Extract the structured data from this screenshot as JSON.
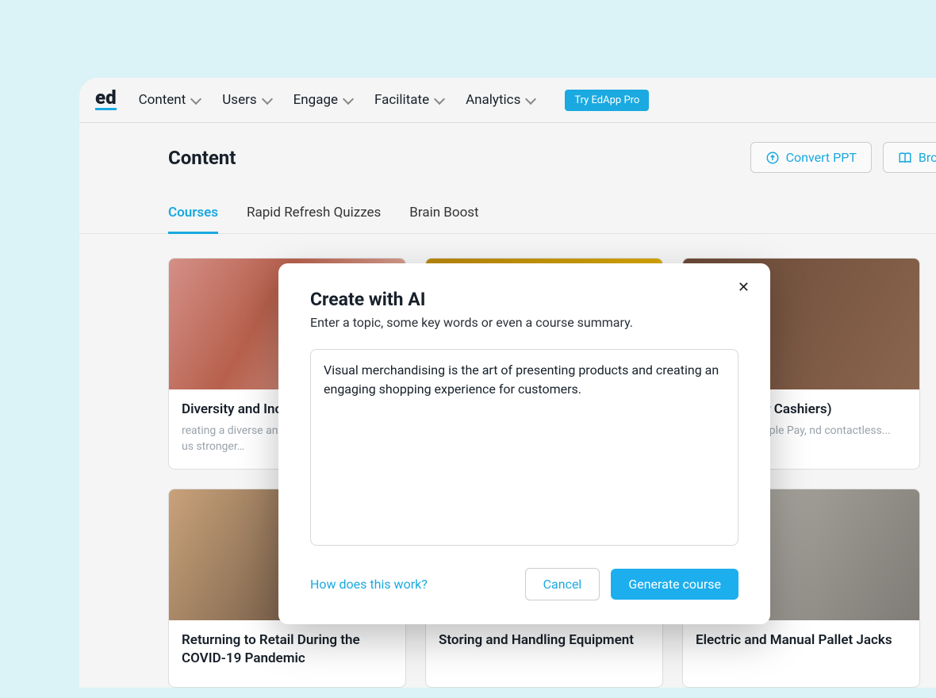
{
  "logo": "ed",
  "nav": {
    "items": [
      {
        "label": "Content"
      },
      {
        "label": "Users"
      },
      {
        "label": "Engage"
      },
      {
        "label": "Facilitate"
      },
      {
        "label": "Analytics"
      }
    ],
    "try_pro": "Try EdApp Pro"
  },
  "page": {
    "title": "Content",
    "actions": {
      "convert_ppt": "Convert PPT",
      "browse": "Browse"
    }
  },
  "tabs": [
    {
      "label": "Courses",
      "active": true
    },
    {
      "label": "Rapid Refresh Quizzes",
      "active": false
    },
    {
      "label": "Brain Boost",
      "active": false
    }
  ],
  "cards": [
    {
      "title": "Diversity and Inclusion in Retail",
      "desc": "reating a diverse and inclusive only makes us stronger…"
    },
    {
      "title": "",
      "desc": ""
    },
    {
      "title": "Security (for Cashiers)",
      "desc": "use Square, Apple Pay, nd contactless..."
    },
    {
      "title": "Returning to Retail During the COVID-19 Pandemic",
      "desc": ""
    },
    {
      "title": "Storing and Handling Equipment",
      "desc": ""
    },
    {
      "title": "Electric and Manual Pallet Jacks",
      "desc": ""
    }
  ],
  "modal": {
    "title": "Create with AI",
    "subtitle": "Enter a topic, some key words or even a course summary.",
    "textarea_value": "Visual merchandising is the art of presenting products and creating an engaging shopping experience for customers.",
    "help_link": "How does this work?",
    "cancel": "Cancel",
    "generate": "Generate course"
  }
}
